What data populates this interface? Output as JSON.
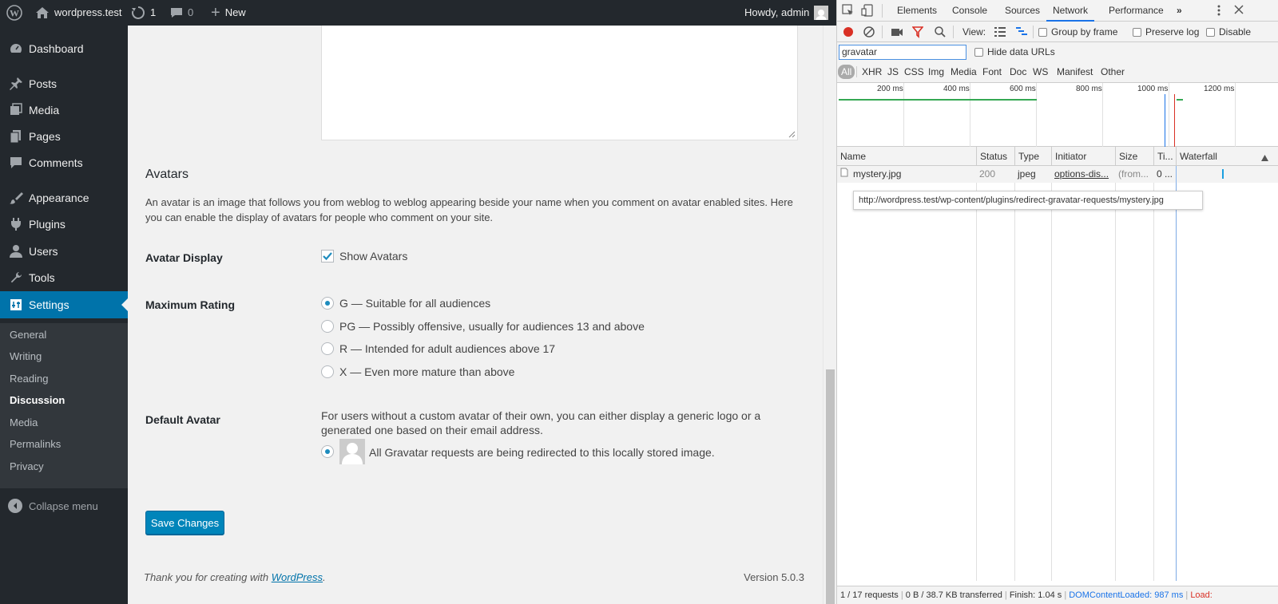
{
  "adminbar": {
    "site_name": "wordpress.test",
    "updates_count": "1",
    "comments_count": "0",
    "new_label": "New",
    "howdy": "Howdy, admin"
  },
  "menu": {
    "items": [
      {
        "label": "Dashboard",
        "icon": "dashboard-icon"
      },
      {
        "label": "Posts",
        "icon": "pin-icon"
      },
      {
        "label": "Media",
        "icon": "media-icon"
      },
      {
        "label": "Pages",
        "icon": "pages-icon"
      },
      {
        "label": "Comments",
        "icon": "comment-icon"
      },
      {
        "label": "Appearance",
        "icon": "brush-icon"
      },
      {
        "label": "Plugins",
        "icon": "plugin-icon"
      },
      {
        "label": "Users",
        "icon": "user-icon"
      },
      {
        "label": "Tools",
        "icon": "wrench-icon"
      },
      {
        "label": "Settings",
        "icon": "settings-icon"
      }
    ],
    "submenu": [
      "General",
      "Writing",
      "Reading",
      "Discussion",
      "Media",
      "Permalinks",
      "Privacy"
    ],
    "collapse": "Collapse menu"
  },
  "main": {
    "avatars_heading": "Avatars",
    "avatars_desc": "An avatar is an image that follows you from weblog to weblog appearing beside your name when you comment on avatar enabled sites. Here you can enable the display of avatars for people who comment on your site.",
    "avatar_display_label": "Avatar Display",
    "show_avatars": "Show Avatars",
    "max_rating_label": "Maximum Rating",
    "ratings": [
      "G — Suitable for all audiences",
      "PG — Possibly offensive, usually for audiences 13 and above",
      "R — Intended for adult audiences above 17",
      "X — Even more mature than above"
    ],
    "default_avatar_label": "Default Avatar",
    "default_avatar_desc": "For users without a custom avatar of their own, you can either display a generic logo or a generated one based on their email address.",
    "default_avatar_option": "All Gravatar requests are being redirected to this locally stored image.",
    "save_button": "Save Changes"
  },
  "footer": {
    "thanks_prefix": "Thank you for creating with ",
    "thanks_link": "WordPress",
    "thanks_suffix": ".",
    "version": "Version 5.0.3"
  },
  "devtools": {
    "tabs": [
      "Elements",
      "Console",
      "Sources",
      "Network",
      "Performance",
      "»"
    ],
    "toolbar": {
      "view": "View:",
      "group_by_frame": "Group by frame",
      "preserve_log": "Preserve log",
      "disable": "Disable"
    },
    "filter": {
      "value": "gravatar",
      "hide_data_urls": "Hide data URLs",
      "types": [
        "All",
        "XHR",
        "JS",
        "CSS",
        "Img",
        "Media",
        "Font",
        "Doc",
        "WS",
        "Manifest",
        "Other"
      ]
    },
    "overview_ticks": [
      "200 ms",
      "400 ms",
      "600 ms",
      "800 ms",
      "1000 ms",
      "1200 ms"
    ],
    "columns": [
      "Name",
      "Status",
      "Type",
      "Initiator",
      "Size",
      "Ti...",
      "Waterfall"
    ],
    "row": {
      "name": "mystery.jpg",
      "status": "200",
      "type": "jpeg",
      "initiator": "options-dis...",
      "size": "(from...",
      "time": "0 ..."
    },
    "tooltip": "http://wordpress.test/wp-content/plugins/redirect-gravatar-requests/mystery.jpg",
    "status": {
      "requests": "1 / 17 requests",
      "transferred": "0 B / 38.7 KB transferred",
      "finish": "Finish: 1.04 s",
      "dcl": "DOMContentLoaded: 987 ms",
      "load": "Load:"
    },
    "colors": {
      "active_tab": "#1a73e8",
      "dcl": "#1a73e8",
      "load": "#d93025",
      "record": "#d93025"
    }
  }
}
